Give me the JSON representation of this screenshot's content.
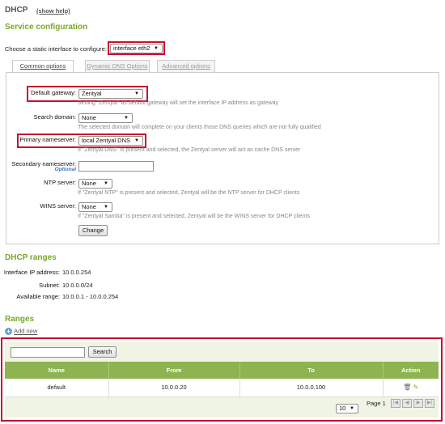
{
  "header": {
    "title": "DHCP",
    "show_help": "(show help)"
  },
  "service_config": {
    "title": "Service configuration",
    "iface_label": "Choose a static interface to configure:",
    "iface_value": "interface eth2"
  },
  "tabs": [
    {
      "label": "Common options"
    },
    {
      "label": "Dynamic DNS Options"
    },
    {
      "label": "Advanced options"
    }
  ],
  "form": {
    "default_gateway": {
      "label": "Default gateway:",
      "value": "Zentyal",
      "help": "Setting \"Zentyal\" as default gateway will set the interface IP address as gateway"
    },
    "search_domain": {
      "label": "Search domain:",
      "value": "None",
      "help": "The selected domain will complete on your clients those DNS queries which are not fully qualified"
    },
    "primary_ns": {
      "label": "Primary nameserver:",
      "value": "local Zentyal DNS",
      "help": "If \"Zentyal DNS\" is present and selected, the Zentyal server will act as cache DNS server"
    },
    "secondary_ns": {
      "label": "Secondary nameserver:",
      "optional": "Optional",
      "value": ""
    },
    "ntp": {
      "label": "NTP server:",
      "value": "None",
      "help": "If \"Zentyal NTP\" is present and selected, Zentyal will be the NTP server for DHCP clients"
    },
    "wins": {
      "label": "WINS server:",
      "value": "None",
      "help": "If \"Zentyal Samba\" is present and selected, Zentyal will be the WINS server for DHCP clients"
    },
    "change_button": "Change"
  },
  "dhcp_ranges": {
    "title": "DHCP ranges",
    "iface_ip_label": "Interface IP address:",
    "iface_ip_value": "10.0.0.254",
    "subnet_label": "Subnet:",
    "subnet_value": "10.0.0.0/24",
    "available_label": "Available range:",
    "available_value": "10.0.0.1 - 10.0.0.254"
  },
  "ranges": {
    "title": "Ranges",
    "add_new": "Add new",
    "search_value": "",
    "search_button": "Search",
    "columns": [
      "Name",
      "From",
      "To",
      "Action"
    ],
    "rows": [
      {
        "name": "default",
        "from": "10.0.0.20",
        "to": "10.0.0.100"
      }
    ],
    "page_size": "10",
    "page_label": "Page 1"
  },
  "colors": {
    "accent": "#7aa72a",
    "highlight": "#c8102e",
    "table_header": "#8db450"
  }
}
